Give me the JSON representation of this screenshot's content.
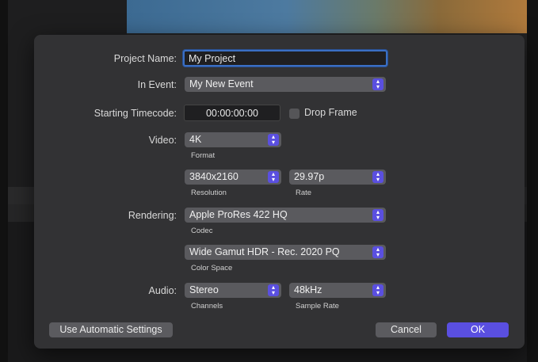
{
  "dialog": {
    "project_name": {
      "label": "Project Name:",
      "value": "My Project"
    },
    "in_event": {
      "label": "In Event:",
      "value": "My New Event"
    },
    "starting_timecode": {
      "label": "Starting Timecode:",
      "value": "00:00:00:00",
      "drop_frame_label": "Drop Frame",
      "drop_frame_checked": false
    },
    "video": {
      "label": "Video:",
      "format": {
        "value": "4K",
        "caption": "Format"
      },
      "resolution": {
        "value": "3840x2160",
        "caption": "Resolution"
      },
      "rate": {
        "value": "29.97p",
        "caption": "Rate"
      }
    },
    "rendering": {
      "label": "Rendering:",
      "codec": {
        "value": "Apple ProRes 422 HQ",
        "caption": "Codec"
      },
      "color_space": {
        "value": "Wide Gamut HDR - Rec. 2020 PQ",
        "caption": "Color Space"
      }
    },
    "audio": {
      "label": "Audio:",
      "channels": {
        "value": "Stereo",
        "caption": "Channels"
      },
      "sample_rate": {
        "value": "48kHz",
        "caption": "Sample Rate"
      }
    },
    "buttons": {
      "automatic": "Use Automatic Settings",
      "cancel": "Cancel",
      "ok": "OK"
    }
  },
  "colors": {
    "accent": "#5a4fe0",
    "focus": "#3a6fc4",
    "dialog_bg": "#323234"
  }
}
